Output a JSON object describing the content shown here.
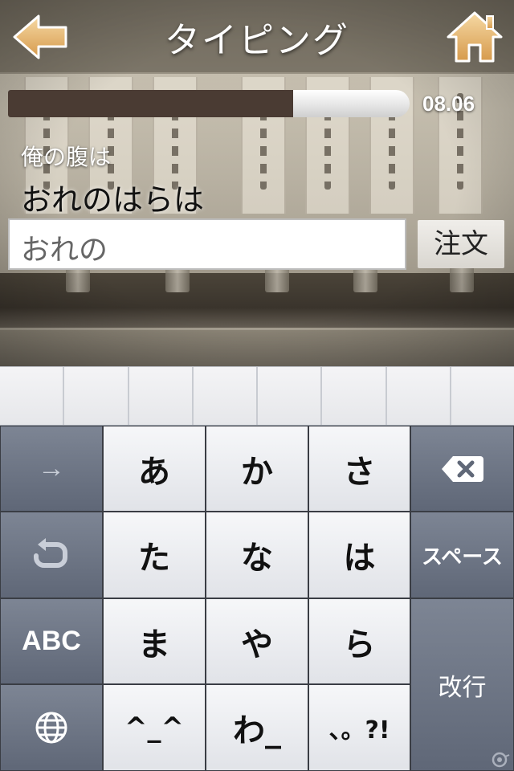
{
  "nav": {
    "title": "タイピング",
    "back_icon": "back-arrow-icon",
    "home_icon": "home-icon",
    "icon_color": "#e8b46a"
  },
  "progress": {
    "fraction": 0.71,
    "fill_color": "#4a3b33",
    "timer": "08.06"
  },
  "prompt": {
    "kanji": "俺の腹は",
    "kana": "おれのはらは"
  },
  "input": {
    "value": "おれの"
  },
  "order_button": {
    "label": "注文"
  },
  "candidate_bar": {
    "cells": 8
  },
  "keyboard": {
    "left_column": [
      {
        "name": "next-arrow-key",
        "label": "→",
        "icon": "arrow-right-icon"
      },
      {
        "name": "undo-key",
        "label": "",
        "icon": "undo-icon"
      },
      {
        "name": "abc-key",
        "label": "ABC",
        "icon": ""
      },
      {
        "name": "globe-key",
        "label": "",
        "icon": "globe-icon"
      }
    ],
    "rows": [
      [
        "あ",
        "か",
        "さ"
      ],
      [
        "た",
        "な",
        "は"
      ],
      [
        "ま",
        "や",
        "ら"
      ],
      [
        "^_^",
        "わ_",
        "、。?!"
      ]
    ],
    "right_column": {
      "delete_icon": "backspace-icon",
      "space_label": "スペース",
      "return_label": "改行"
    }
  }
}
